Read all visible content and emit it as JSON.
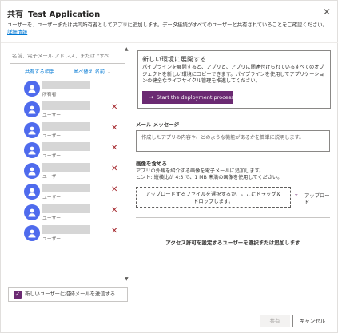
{
  "header": {
    "title": "共有",
    "app_name": "Test Application",
    "close_icon": "close-icon"
  },
  "description": {
    "text": "ユーザーを、ユーザーまたは共同所有者としてアプリに追加します。データ接続がすべてのユーザーと共有されていることをご確認ください。",
    "link": "詳細情報"
  },
  "left_pane": {
    "search_placeholder": "名前、電子メール アドレス、または \"すべ...",
    "columns": {
      "shared_with": "共有する相手",
      "sort_by": "並べ替え 名前"
    },
    "users": [
      {
        "role": "所有者",
        "removable": false
      },
      {
        "role": "ユーザー",
        "removable": true
      },
      {
        "role": "ユーザー",
        "removable": true
      },
      {
        "role": "ユーザー",
        "removable": true
      },
      {
        "role": "ユーザー",
        "removable": true
      },
      {
        "role": "ユーザー",
        "removable": true
      },
      {
        "role": "ユーザー",
        "removable": true
      },
      {
        "role": "ユーザー",
        "removable": true
      }
    ],
    "send_invite_label": "新しいユーザーに招待メールを送信する",
    "send_invite_checked": true
  },
  "deploy": {
    "title": "新しい環境に展開する",
    "description": "パイプラインを展開すると、アプリと、アプリに関連付けられているすべてのオブジェクトを新しい環境にコピーできます。パイプラインを使用してアプリケーションの健全なライフサイクル管理を推進してください。",
    "button_label": "Start the deployment process"
  },
  "email": {
    "label": "メール メッセージ",
    "placeholder": "作成したアプリの内容や、どのような機能があるかを簡単に説明します。"
  },
  "image": {
    "label": "画像を含める",
    "hint1": "アプリの外観を紹介する画像を電子メールに追加します。",
    "hint2": "ヒント: 縦横比が 4:3 で、1 MB 未満の画像を使用してください。",
    "upload_box_text": "アップロードするファイルを選択するか、ここにドラッグ＆ドロップします。",
    "upload_action": "アップロード"
  },
  "empty_state": "アクセス許可を設定するユーザーを選択または追加します",
  "footer": {
    "share": "共有",
    "cancel": "キャンセル"
  },
  "colors": {
    "accent": "#6b2a72",
    "avatar": "#4f6bed",
    "remove": "#a4262c",
    "link": "#0078d4"
  }
}
